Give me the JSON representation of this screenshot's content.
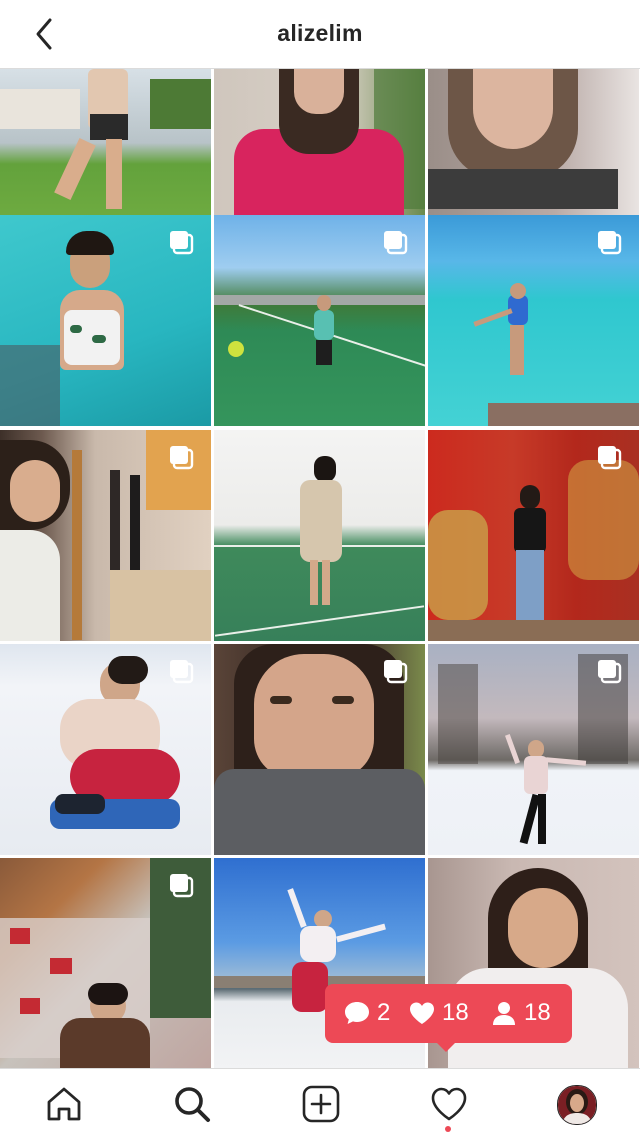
{
  "header": {
    "title": "alizelim"
  },
  "notification": {
    "comments": "2",
    "likes": "18",
    "follows": "18"
  },
  "tabs": [
    "home-icon",
    "search-icon",
    "new-post-icon",
    "activity-icon",
    "profile-icon"
  ],
  "colors": {
    "accent": "#ed4956",
    "text": "#262626",
    "border": "#dbdbdb"
  }
}
